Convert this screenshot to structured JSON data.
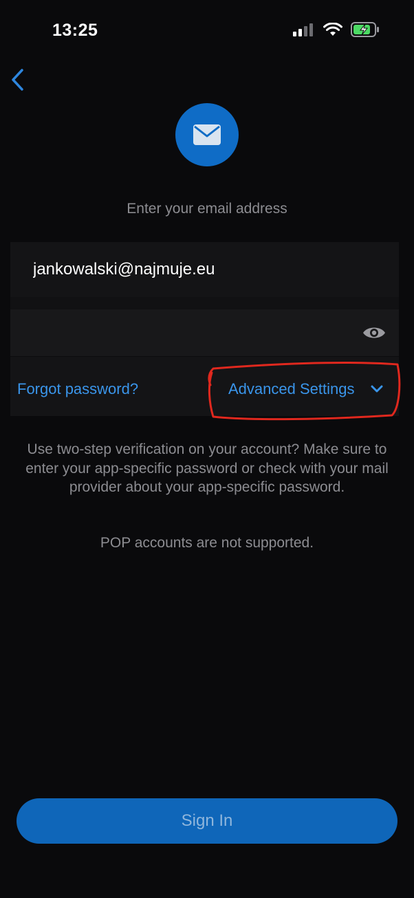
{
  "status_bar": {
    "time": "13:25",
    "icons": [
      "cellular-signal-icon",
      "wifi-icon",
      "battery-charging-icon"
    ]
  },
  "nav": {
    "back_icon": "chevron-left-icon"
  },
  "header": {
    "logo_icon": "envelope-icon",
    "prompt": "Enter your email address"
  },
  "form": {
    "email_value": "jankowalski@najmuje.eu",
    "password_value": "",
    "eye_icon": "eye-icon",
    "forgot_label": "Forgot password?",
    "advanced_label": "Advanced Settings",
    "advanced_icon": "chevron-down-icon"
  },
  "info": {
    "two_step": "Use two-step verification on your account? Make sure to enter your app-specific password or check with your mail provider about your app-specific password.",
    "pop_notice": "POP accounts are not supported."
  },
  "actions": {
    "sign_in_label": "Sign In"
  },
  "colors": {
    "background": "#0a0a0c",
    "accent": "#3a95ea",
    "button": "#0f66b9",
    "annotation": "#e0281e"
  }
}
